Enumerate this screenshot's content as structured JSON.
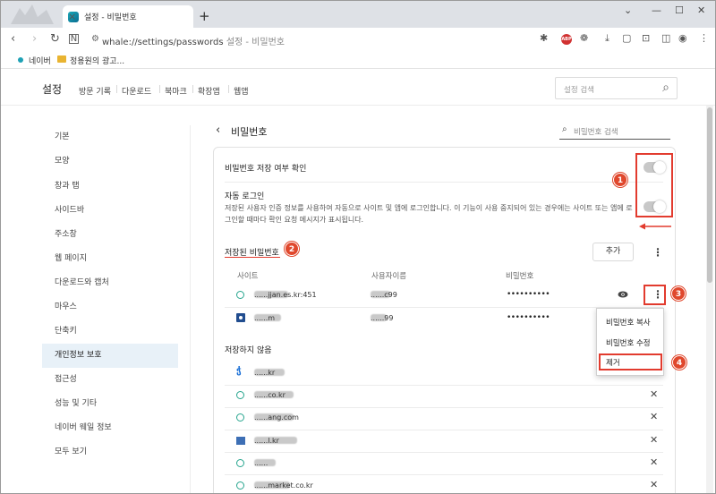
{
  "browser": {
    "tab_title": "설정 - 비밀번호",
    "tab_close": "×",
    "new_tab": "+",
    "window_controls": [
      "⌄",
      "—",
      "☐",
      "✕"
    ],
    "url_main": "whale://settings/passwords",
    "url_page": "설정 - 비밀번호",
    "abp_label": "ABP"
  },
  "bookmarks": [
    {
      "label": "네이버",
      "icon": "green-dot-icon"
    },
    {
      "label": "정용원의 광고...",
      "icon": "folder-icon"
    }
  ],
  "settings_header": {
    "title": "설정",
    "nav": [
      "방문 기록",
      "다운로드",
      "북마크",
      "확장앱",
      "웹앱"
    ],
    "search_placeholder": "설정 검색"
  },
  "sidebar": {
    "items": [
      "기본",
      "모양",
      "창과 탭",
      "사이드바",
      "주소창",
      "웹 페이지",
      "다운로드와 캡처",
      "마우스",
      "단축키",
      "개인정보 보호",
      "접근성",
      "성능 및 기타",
      "네이버 웨일 정보",
      "모두 보기"
    ],
    "active_index": 9
  },
  "main": {
    "back_label": "‹",
    "title": "비밀번호",
    "search_placeholder": "비밀번호 검색",
    "save_check_label": "비밀번호 저장 여부 확인",
    "save_check_on": false,
    "autologin_label": "자동 로그인",
    "autologin_desc": "저장된 사용자 인증 정보를 사용하여 자동으로 사이트 및 앱에 로그인합니다. 이 기능이 사용 중지되어 있는 경우에는 사이트 또는 앱에 로그인할 때마다 확인 요청 메시지가 표시됩니다.",
    "autologin_on": false,
    "saved_title": "저장된 비밀번호",
    "add_label": "추가",
    "columns": [
      "사이트",
      "사용자이름",
      "비밀번호"
    ],
    "saved_rows": [
      {
        "site": "......jjan.es.kr:451",
        "user": "......c99",
        "password": "••••••••••"
      },
      {
        "site": "......m",
        "user": "......99",
        "password": "••••••••••"
      }
    ],
    "never_title": "저장하지 않음",
    "never_rows": [
      {
        "site": "......kr",
        "icon": "s-logo-icon"
      },
      {
        "site": "......co.kr",
        "icon": "ring-icon"
      },
      {
        "site": "......ang.com",
        "icon": "ring-icon"
      },
      {
        "site": "......l.kr",
        "icon": "blue-logo-icon"
      },
      {
        "site": "......",
        "icon": "ring-icon"
      },
      {
        "site": "......market.co.kr",
        "icon": "ring-icon"
      }
    ],
    "row_menu": [
      "비밀번호 복사",
      "비밀번호 수정",
      "제거"
    ]
  },
  "annotations": [
    "1",
    "2",
    "3",
    "4"
  ],
  "colors": {
    "annotation_red": "#e23b2e",
    "badge_red": "#e0482d",
    "active_sidebar": "#e8f1f8",
    "site_ring_green": "#26a58e"
  }
}
